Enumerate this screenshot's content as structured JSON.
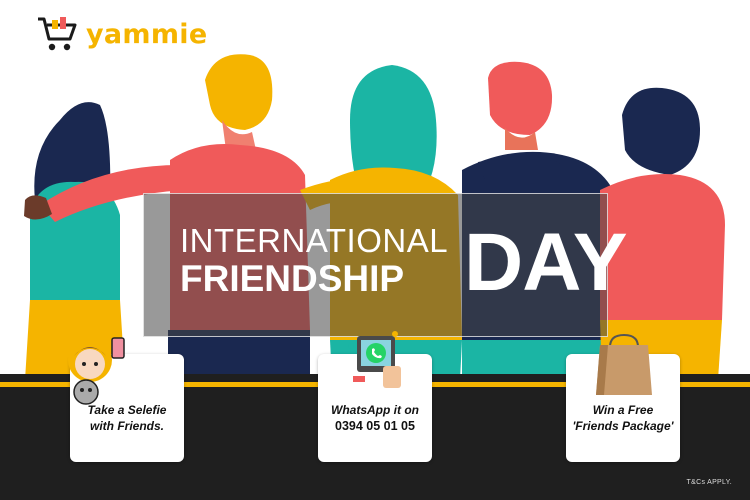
{
  "brand": {
    "name": "yammie",
    "color": "#f5b400"
  },
  "title": {
    "line1": "INTERNATIONAL",
    "line2": "FRIENDSHIP",
    "big": "DAY"
  },
  "cards": [
    {
      "line1": "Take a Selefie",
      "line2": "with Friends.",
      "icon": "selfie-girl-icon"
    },
    {
      "line1": "WhatsApp it on",
      "line2": "0394 05 01 05",
      "icon": "whatsapp-phone-icon"
    },
    {
      "line1": "Win a Free",
      "line2": "'Friends Package'",
      "icon": "gift-bag-icon"
    }
  ],
  "footer": {
    "tnc": "T&Cs APPLY."
  },
  "colors": {
    "band": "#1f1f1f",
    "stripe": "#f5b400",
    "accent_red": "#f05a5a",
    "teal": "#1bb5a4",
    "navy": "#1a2850"
  }
}
